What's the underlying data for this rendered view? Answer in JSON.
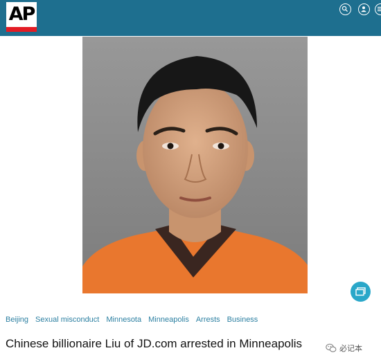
{
  "header": {
    "logo_text": "AP",
    "icons": [
      "search-icon",
      "account-icon",
      "menu-icon"
    ],
    "colors": {
      "bar": "#1e6f8f",
      "logo_red": "#e31c24"
    }
  },
  "story": {
    "tags": [
      "Beijing",
      "Sexual misconduct",
      "Minnesota",
      "Minneapolis",
      "Arrests",
      "Business"
    ],
    "headline": "Chinese billionaire Liu of JD.com arrested in Minneapolis"
  },
  "fab": {
    "icon": "gallery-icon",
    "color": "#2aa7c9"
  },
  "watermark": {
    "text": "必记本",
    "icon": "wechat-icon"
  }
}
